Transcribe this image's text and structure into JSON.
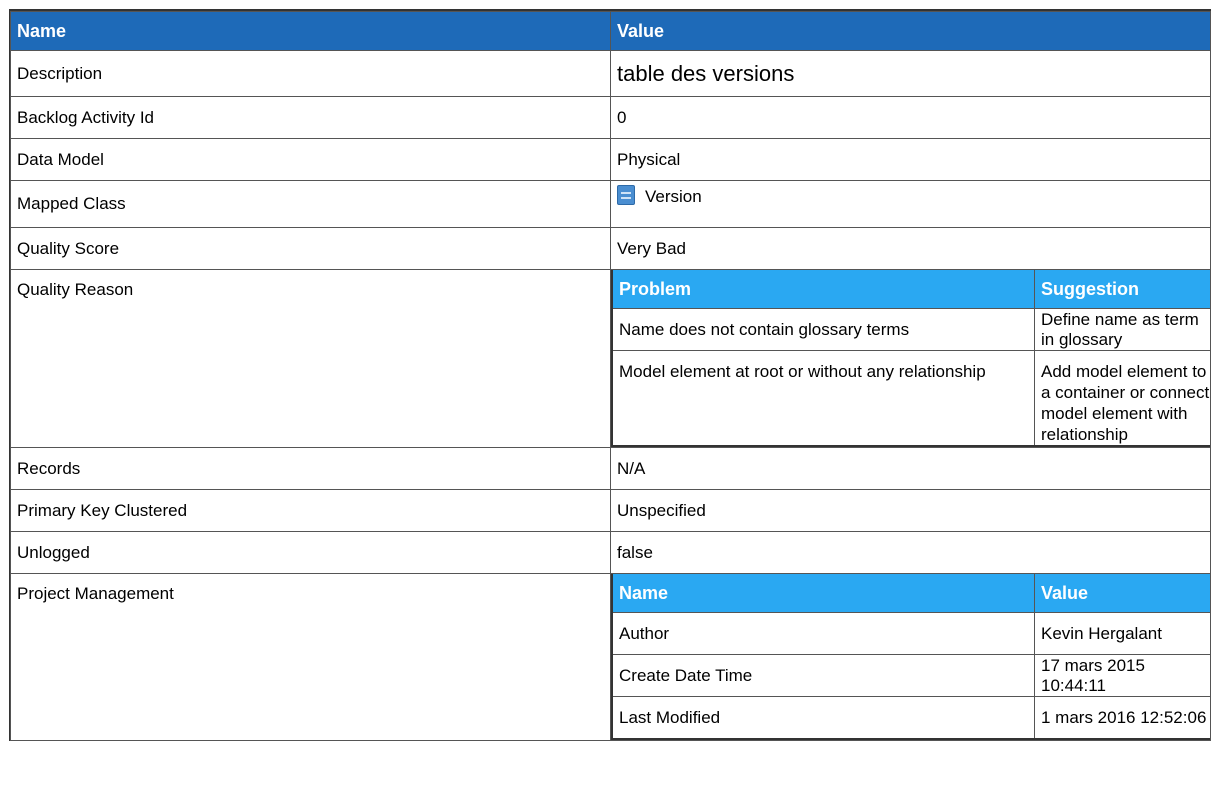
{
  "header": {
    "name": "Name",
    "value": "Value"
  },
  "rows": {
    "description": {
      "label": "Description",
      "value": "table des versions"
    },
    "backlog": {
      "label": "Backlog Activity Id",
      "value": "0"
    },
    "data_model": {
      "label": "Data Model",
      "value": "Physical"
    },
    "mapped_class": {
      "label": "Mapped Class",
      "value": "Version",
      "icon": "class-icon"
    },
    "quality_score": {
      "label": "Quality Score",
      "value": "Very Bad"
    },
    "quality_reason": {
      "label": "Quality Reason",
      "headers": {
        "problem": "Problem",
        "suggestion": "Suggestion"
      },
      "items": [
        {
          "problem": "Name does not contain glossary terms",
          "suggestion": "Define name as term in glossary"
        },
        {
          "problem": "Model element at root or without any relationship",
          "suggestion": "Add model element to a container or connect model element with relationship"
        }
      ]
    },
    "records": {
      "label": "Records",
      "value": "N/A"
    },
    "pk_clustered": {
      "label": "Primary Key Clustered",
      "value": "Unspecified"
    },
    "unlogged": {
      "label": "Unlogged",
      "value": "false"
    },
    "project_management": {
      "label": "Project Management",
      "headers": {
        "name": "Name",
        "value": "Value"
      },
      "items": [
        {
          "name": "Author",
          "value": "Kevin Hergalant"
        },
        {
          "name": "Create Date Time",
          "value": "17 mars 2015 10:44:11"
        },
        {
          "name": "Last Modified",
          "value": "1 mars 2016 12:52:06"
        }
      ]
    }
  },
  "colors": {
    "header_dark": "#1e6ab8",
    "header_light": "#2aa8f2"
  }
}
